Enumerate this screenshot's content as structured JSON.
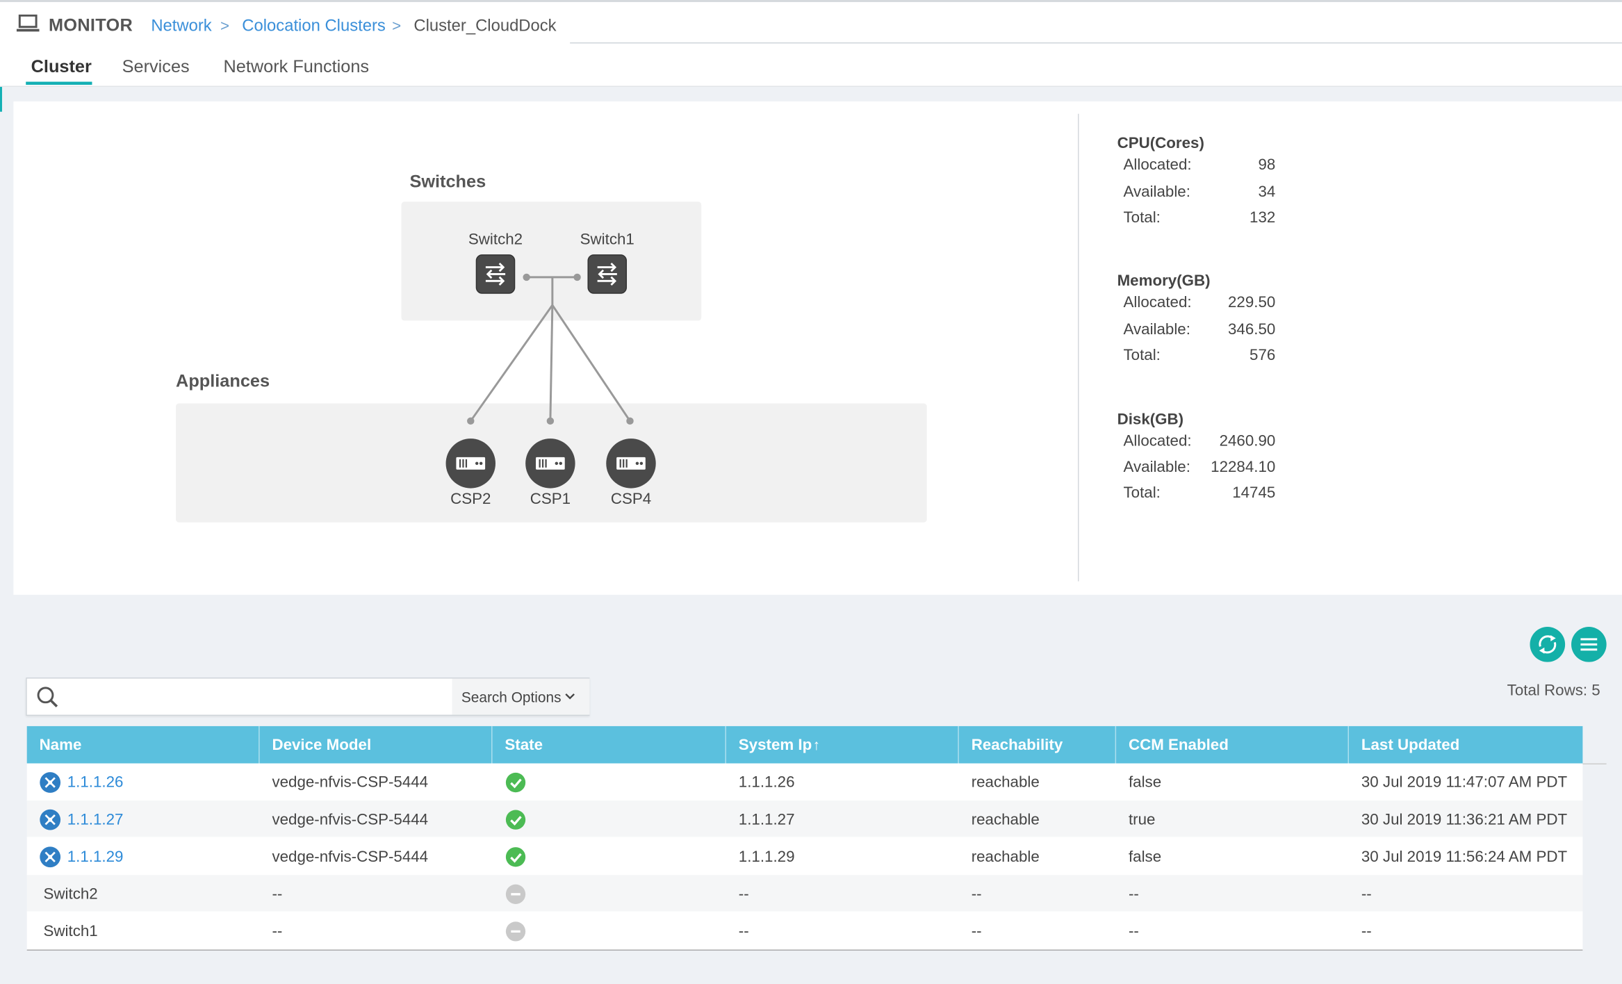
{
  "header": {
    "app_title": "MONITOR",
    "breadcrumbs": [
      {
        "label": "Network"
      },
      {
        "label": "Colocation Clusters"
      },
      {
        "label": "Cluster_CloudDock"
      }
    ],
    "separator": ">",
    "icon": "laptop-icon"
  },
  "tabs": [
    {
      "label": "Cluster",
      "active": true
    },
    {
      "label": "Services",
      "active": false
    },
    {
      "label": "Network Functions",
      "active": false
    }
  ],
  "topology": {
    "switches_title": "Switches",
    "appliances_title": "Appliances",
    "switches": [
      {
        "label": "Switch2",
        "icon": "switch-icon"
      },
      {
        "label": "Switch1",
        "icon": "switch-icon"
      }
    ],
    "appliances": [
      {
        "label": "CSP2",
        "icon": "server-icon"
      },
      {
        "label": "CSP1",
        "icon": "server-icon"
      },
      {
        "label": "CSP4",
        "icon": "server-icon"
      }
    ]
  },
  "stats": {
    "cpu": {
      "title": "CPU(Cores)",
      "allocated_label": "Allocated:",
      "allocated": "98",
      "available_label": "Available:",
      "available": "34",
      "total_label": "Total:",
      "total": "132"
    },
    "memory": {
      "title": "Memory(GB)",
      "allocated_label": "Allocated:",
      "allocated": "229.50",
      "available_label": "Available:",
      "available": "346.50",
      "total_label": "Total:",
      "total": "576"
    },
    "disk": {
      "title": "Disk(GB)",
      "allocated_label": "Allocated:",
      "allocated": "2460.90",
      "available_label": "Available:",
      "available": "12284.10",
      "total_label": "Total:",
      "total": "14745"
    }
  },
  "toolbar": {
    "refresh_icon": "refresh-icon",
    "menu_icon": "menu-icon",
    "total_rows": "Total Rows: 5"
  },
  "search": {
    "placeholder": "",
    "value": "",
    "options_label": "Search Options"
  },
  "table": {
    "columns": [
      "Name",
      "Device Model",
      "State",
      "System Ip",
      "Reachability",
      "CCM Enabled",
      "Last Updated"
    ],
    "sort_indicator": "↑",
    "rows": [
      {
        "name": "1.1.1.26",
        "model": "vedge-nfvis-CSP-5444",
        "state": "ok",
        "system_ip": "1.1.1.26",
        "reachability": "reachable",
        "ccm": "false",
        "updated": "30 Jul 2019 11:47:07 AM PDT"
      },
      {
        "name": "1.1.1.27",
        "model": "vedge-nfvis-CSP-5444",
        "state": "ok",
        "system_ip": "1.1.1.27",
        "reachability": "reachable",
        "ccm": "true",
        "updated": "30 Jul 2019 11:36:21 AM PDT"
      },
      {
        "name": "1.1.1.29",
        "model": "vedge-nfvis-CSP-5444",
        "state": "ok",
        "system_ip": "1.1.1.29",
        "reachability": "reachable",
        "ccm": "false",
        "updated": "30 Jul 2019 11:56:24 AM PDT"
      },
      {
        "name": "Switch2",
        "model": "--",
        "state": "na",
        "system_ip": "--",
        "reachability": "--",
        "ccm": "--",
        "updated": "--"
      },
      {
        "name": "Switch1",
        "model": "--",
        "state": "na",
        "system_ip": "--",
        "reachability": "--",
        "ccm": "--",
        "updated": "--"
      }
    ]
  },
  "colors": {
    "accent_teal": "#14b0b4",
    "table_header": "#5bc0de",
    "link": "#2c8ad8",
    "state_ok": "#4cbb54",
    "state_na": "#c9c9c9"
  }
}
